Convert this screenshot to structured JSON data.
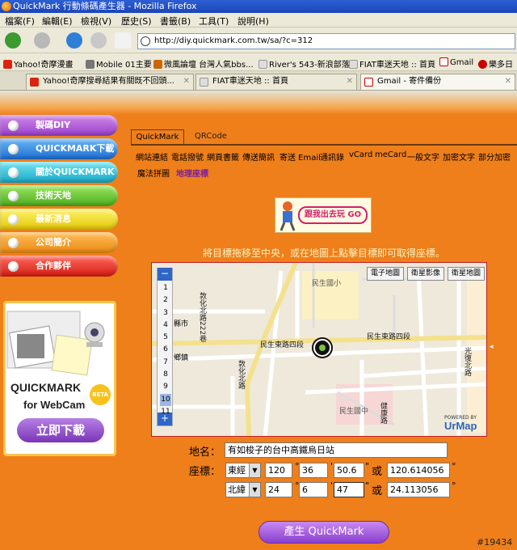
{
  "window": {
    "title": "QuickMark 行動條碼產生器 - Mozilla Firefox"
  },
  "menu": [
    "檔案(F)",
    "編輯(E)",
    "檢視(V)",
    "歷史(S)",
    "書籤(B)",
    "工具(T)",
    "說明(H)"
  ],
  "url": "http://diy.quickmark.com.tw/sa/?c=312",
  "bookmarks": [
    "Yahoo!奇摩漫畫",
    "Mobile 01主要",
    "微風論壇 台灣人氣bbs...",
    "River's 543-新浪部落",
    "FIAT車迷天地 :: 首頁",
    "Gmail",
    "樂多日"
  ],
  "tabs": [
    "Yahoo!奇摩搜尋結果有關既不回頭...",
    "FIAT車迷天地 :: 首頁",
    "Gmail - 寄件備份"
  ],
  "sidebar": [
    "製碼DIY",
    "QUICKMARK下載",
    "關於QUICKMARK",
    "技術天地",
    "最新消息",
    "公司簡介",
    "合作夥伴"
  ],
  "ad": {
    "brand": "QUICKMARK",
    "beta": "BETA",
    "for": "for WebCam",
    "download": "立即下載"
  },
  "content_tabs": [
    "QuickMark",
    "QRCode"
  ],
  "types_row1": [
    "網站連結",
    "電話撥號",
    "網頁書籤",
    "傳送簡訊",
    "寄送 Email",
    "通訊錄",
    "vCard",
    "meCard",
    "一般文字",
    "加密文字",
    "部分加密"
  ],
  "types_row2": [
    "魔法拼圖",
    "地理座標"
  ],
  "banner": "跟我出去玩 GO",
  "instruction": "將目標拖移至中央，或在地圖上點擊目標即可取得座標。",
  "map": {
    "buttons": [
      "電子地圖",
      "衛星影像",
      "衛星地圖"
    ],
    "zoom_levels": [
      "1",
      "2",
      "3",
      "4",
      "5",
      "6",
      "7",
      "8",
      "9",
      "10",
      "11"
    ],
    "zoom_labels": [
      "縣市",
      "鄉鎮"
    ],
    "selected_zoom": "10",
    "streets": [
      "敦化北路222巷",
      "民生東路四段",
      "民生東路四段",
      "敦化北路",
      "健康路",
      "光復北路",
      "民生國小",
      "民生國中"
    ],
    "brand": "UrMap",
    "powered": "POWERED BY"
  },
  "form": {
    "name_label": "地名：",
    "name_value": "有如梭子的台中高鐵烏日站",
    "coord_label": "座標：",
    "lng_dir": "東經",
    "lng_deg": "120",
    "lng_min": "36",
    "lng_sec": "50.6",
    "lat_dir": "北緯",
    "lat_deg": "24",
    "lat_min": "6",
    "lat_sec": "47",
    "or": "或",
    "lng_decimal": "120.614056",
    "lat_decimal": "24.113056",
    "deg_unit": "°",
    "min_unit": "'",
    "sec_unit": "\"",
    "generate": "產生 QuickMark"
  },
  "watermark": "#19434"
}
